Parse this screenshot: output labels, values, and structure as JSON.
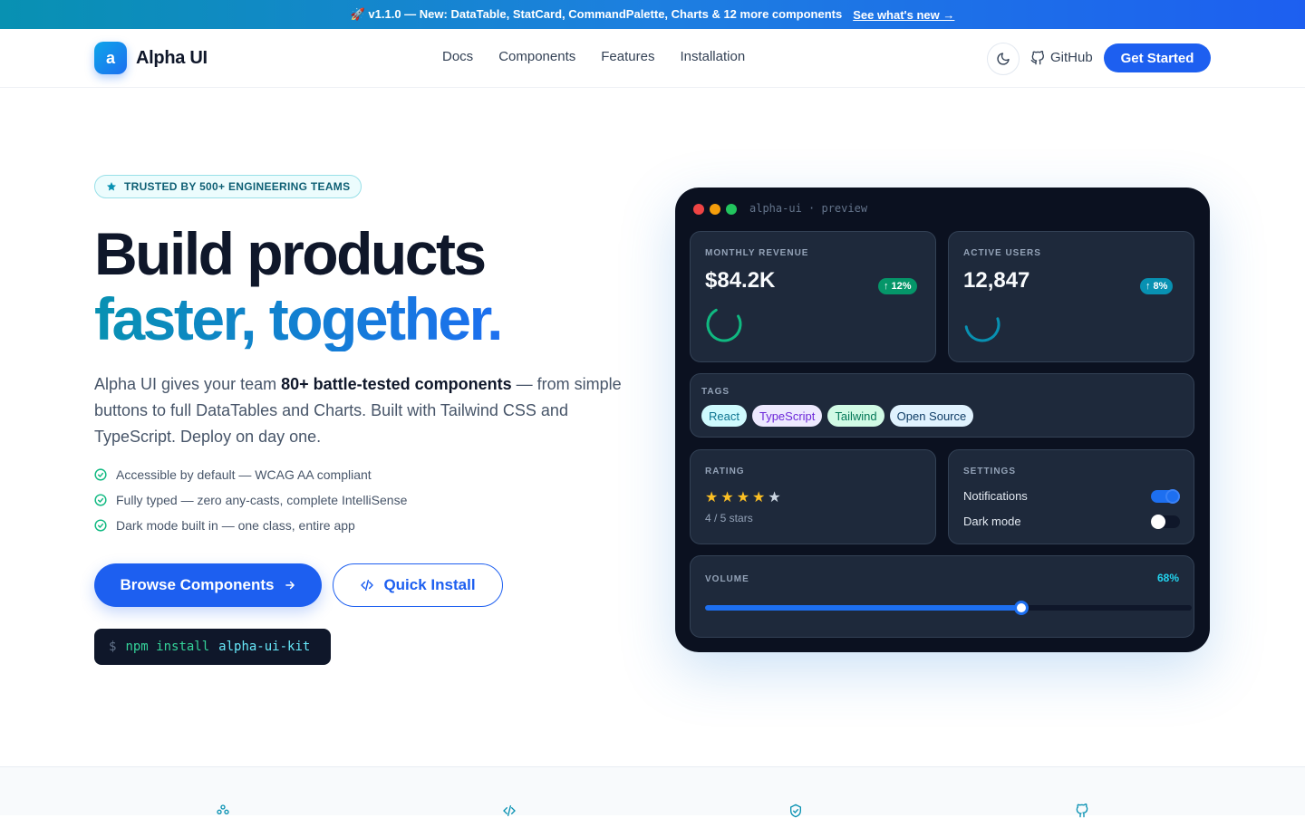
{
  "announcement": {
    "text": "🚀 v1.1.0 — New: DataTable, StatCard, CommandPalette, Charts & 12 more components",
    "link": "See what's new →"
  },
  "nav": {
    "logo_letter": "a",
    "brand": "Alpha UI",
    "links": [
      "Docs",
      "Components",
      "Features",
      "Installation"
    ],
    "github": "GitHub",
    "cta": "Get Started"
  },
  "hero": {
    "badge": "TRUSTED BY 500+ ENGINEERING TEAMS",
    "title_line1": "Build products",
    "title_line2": "faster, together.",
    "sub_prefix": "Alpha UI gives your team ",
    "sub_bold": "80+ battle-tested components",
    "sub_suffix": " — from simple buttons to full DataTables and Charts. Built with Tailwind CSS and TypeScript. Deploy on day one.",
    "checks": [
      "Accessible by default — WCAG AA compliant",
      "Fully typed — zero any-casts, complete IntelliSense",
      "Dark mode built in — one class, entire app"
    ],
    "primary_button": "Browse Components",
    "outline_button": "Quick Install",
    "terminal": {
      "prompt": "$",
      "cmd": "npm install",
      "pkg": "alpha-ui-kit"
    }
  },
  "preview": {
    "title": "alpha-ui · preview",
    "revenue": {
      "label": "MONTHLY REVENUE",
      "value": "$84.2K",
      "change": "↑ 12%"
    },
    "users": {
      "label": "ACTIVE USERS",
      "value": "12,847",
      "change": "↑ 8%"
    },
    "tags": {
      "label": "TAGS",
      "items": [
        "React",
        "TypeScript",
        "Tailwind",
        "Open Source"
      ]
    },
    "rating": {
      "label": "RATING",
      "value": 4,
      "max": 5,
      "text": "4 / 5 stars"
    },
    "settings": {
      "label": "SETTINGS",
      "items": [
        {
          "label": "Notifications",
          "on": true
        },
        {
          "label": "Dark mode",
          "on": false
        }
      ]
    },
    "volume": {
      "label": "VOLUME",
      "value_text": "68%",
      "value": 0.68
    }
  },
  "colors": {
    "primary": "#1d5ff0",
    "accent": "#0891b2",
    "success": "#059669",
    "dark_bg": "#0b1120"
  },
  "features_icons": [
    "components-icon",
    "code-icon",
    "shield-check-icon",
    "github-icon"
  ]
}
